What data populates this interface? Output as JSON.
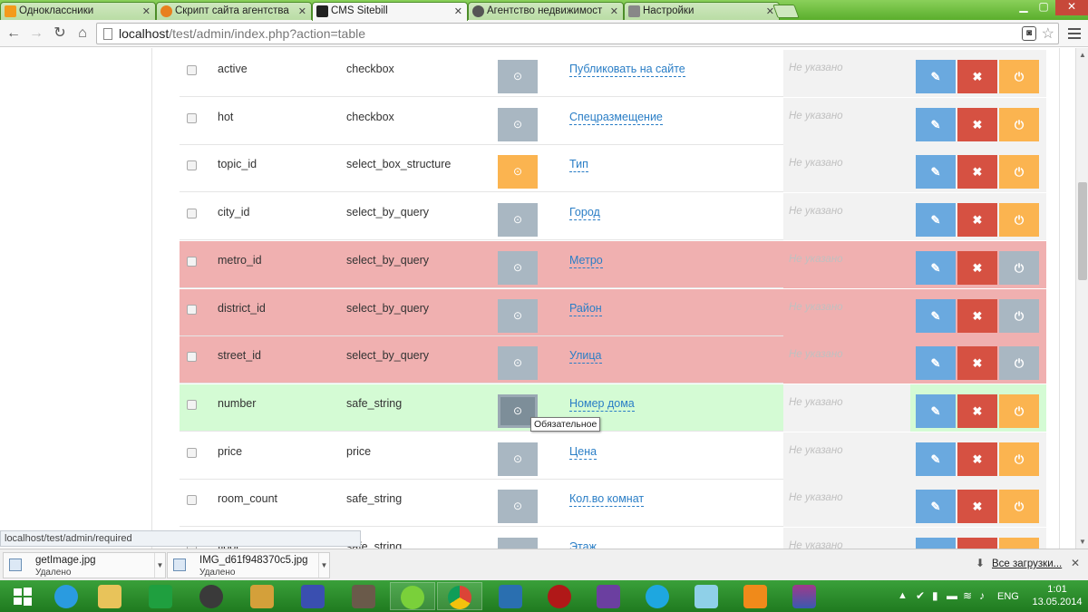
{
  "browser": {
    "tabs": [
      {
        "label": "Одноклассники",
        "icon": "odnoklassniki-icon",
        "color": "#f39a1b"
      },
      {
        "label": "Скрипт сайта агентства н",
        "icon": "site-s-icon",
        "color": "#e8801e"
      },
      {
        "label": "CMS Sitebill",
        "icon": "spy-hat-icon",
        "color": "#222222"
      },
      {
        "label": "Агентство недвижимост",
        "icon": "globe-icon",
        "color": "#555555"
      },
      {
        "label": "Настройки",
        "icon": "wrench-icon",
        "color": "#777777"
      }
    ],
    "url_host": "localhost",
    "url_path": "/test/admin/index.php?action=table",
    "status_url": "localhost/test/admin/required"
  },
  "table": {
    "not_specified": "Не указано",
    "rows": [
      {
        "name": "active",
        "type": "checkbox",
        "title": "Публиковать на сайте",
        "hint": "Не указано",
        "state": "normal",
        "required": false,
        "active": true
      },
      {
        "name": "hot",
        "type": "checkbox",
        "title": "Спецразмещение",
        "hint": "Не указано",
        "state": "normal",
        "required": false,
        "active": true
      },
      {
        "name": "topic_id",
        "type": "select_box_structure",
        "title": "Тип",
        "hint": "Не указано",
        "state": "normal",
        "required": true,
        "active": true
      },
      {
        "name": "city_id",
        "type": "select_by_query",
        "title": "Город",
        "hint": "Не указано",
        "state": "normal",
        "required": false,
        "active": true
      },
      {
        "name": "metro_id",
        "type": "select_by_query",
        "title": "Метро",
        "hint": "Не указано",
        "state": "disabled",
        "required": false,
        "active": false
      },
      {
        "name": "district_id",
        "type": "select_by_query",
        "title": "Район",
        "hint": "Не указано",
        "state": "disabled",
        "required": false,
        "active": false
      },
      {
        "name": "street_id",
        "type": "select_by_query",
        "title": "Улица",
        "hint": "Не указано",
        "state": "disabled",
        "required": false,
        "active": false
      },
      {
        "name": "number",
        "type": "safe_string",
        "title": "Номер дома",
        "hint": "Не указано",
        "state": "highlighted",
        "required": false,
        "active": true
      },
      {
        "name": "price",
        "type": "price",
        "title": "Цена",
        "hint": "Не указано",
        "state": "normal",
        "required": false,
        "active": true
      },
      {
        "name": "room_count",
        "type": "safe_string",
        "title": "Кол.во комнат",
        "hint": "Не указано",
        "state": "normal",
        "required": false,
        "active": true
      },
      {
        "name": "floor",
        "type": "safe_string",
        "title": "Этаж",
        "hint": "Не указано",
        "state": "normal",
        "required": false,
        "active": true
      }
    ],
    "tooltip": "Обязательное"
  },
  "colors": {
    "disabled_row": "#f0b0b0",
    "highlight_row": "#d4fbd4",
    "edit": "#6aa9df",
    "delete": "#d65142",
    "power": "#fbb450",
    "required_on": "#fbb450",
    "required_off": "#a9b7c2"
  },
  "downloads": {
    "items": [
      {
        "filename": "getImage.jpg",
        "status": "Удалено"
      },
      {
        "filename": "IMG_d61f948370c5.jpg",
        "status": "Удалено"
      }
    ],
    "all_label": "Все загрузки..."
  },
  "taskbar": {
    "apps": [
      "start-icon",
      "ie-icon",
      "explorer-icon",
      "store-icon",
      "speaker-icon",
      "photo-icon",
      "save-icon",
      "game-icon",
      "icq-icon",
      "chrome-icon",
      "settings-icon",
      "power-icon",
      "vs-icon",
      "skype-icon",
      "notepad-icon",
      "media-icon",
      "winrar-icon"
    ],
    "lang": "ENG",
    "time": "1:01",
    "date": "13.05.2014"
  }
}
